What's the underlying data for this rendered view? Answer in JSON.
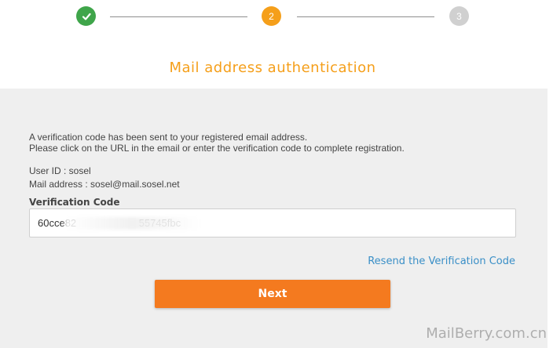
{
  "stepper": {
    "steps": [
      {
        "label": "",
        "state": "completed",
        "icon": "check-icon"
      },
      {
        "label": "2",
        "state": "current"
      },
      {
        "label": "3",
        "state": "upcoming"
      }
    ]
  },
  "title": "Mail address authentication",
  "message": {
    "line1": "A verification code has been sent to your registered email address.",
    "line2": "Please click on the URL in the email or enter the verification code to complete registration."
  },
  "account": {
    "user_id": "User ID : sosel",
    "mail_address": "Mail address : sosel@mail.sosel.net"
  },
  "verification": {
    "label": "Verification Code",
    "value": "60cce82                      55745fbc"
  },
  "resend_label": "Resend the Verification Code",
  "next_label": "Next",
  "watermark": "MailBerry.com.cn",
  "colors": {
    "accent_orange": "#f59f1a",
    "button_orange": "#f47a1f",
    "success_green": "#3fa54a",
    "link_blue": "#3a8fc7",
    "panel_gray": "#efefef"
  }
}
